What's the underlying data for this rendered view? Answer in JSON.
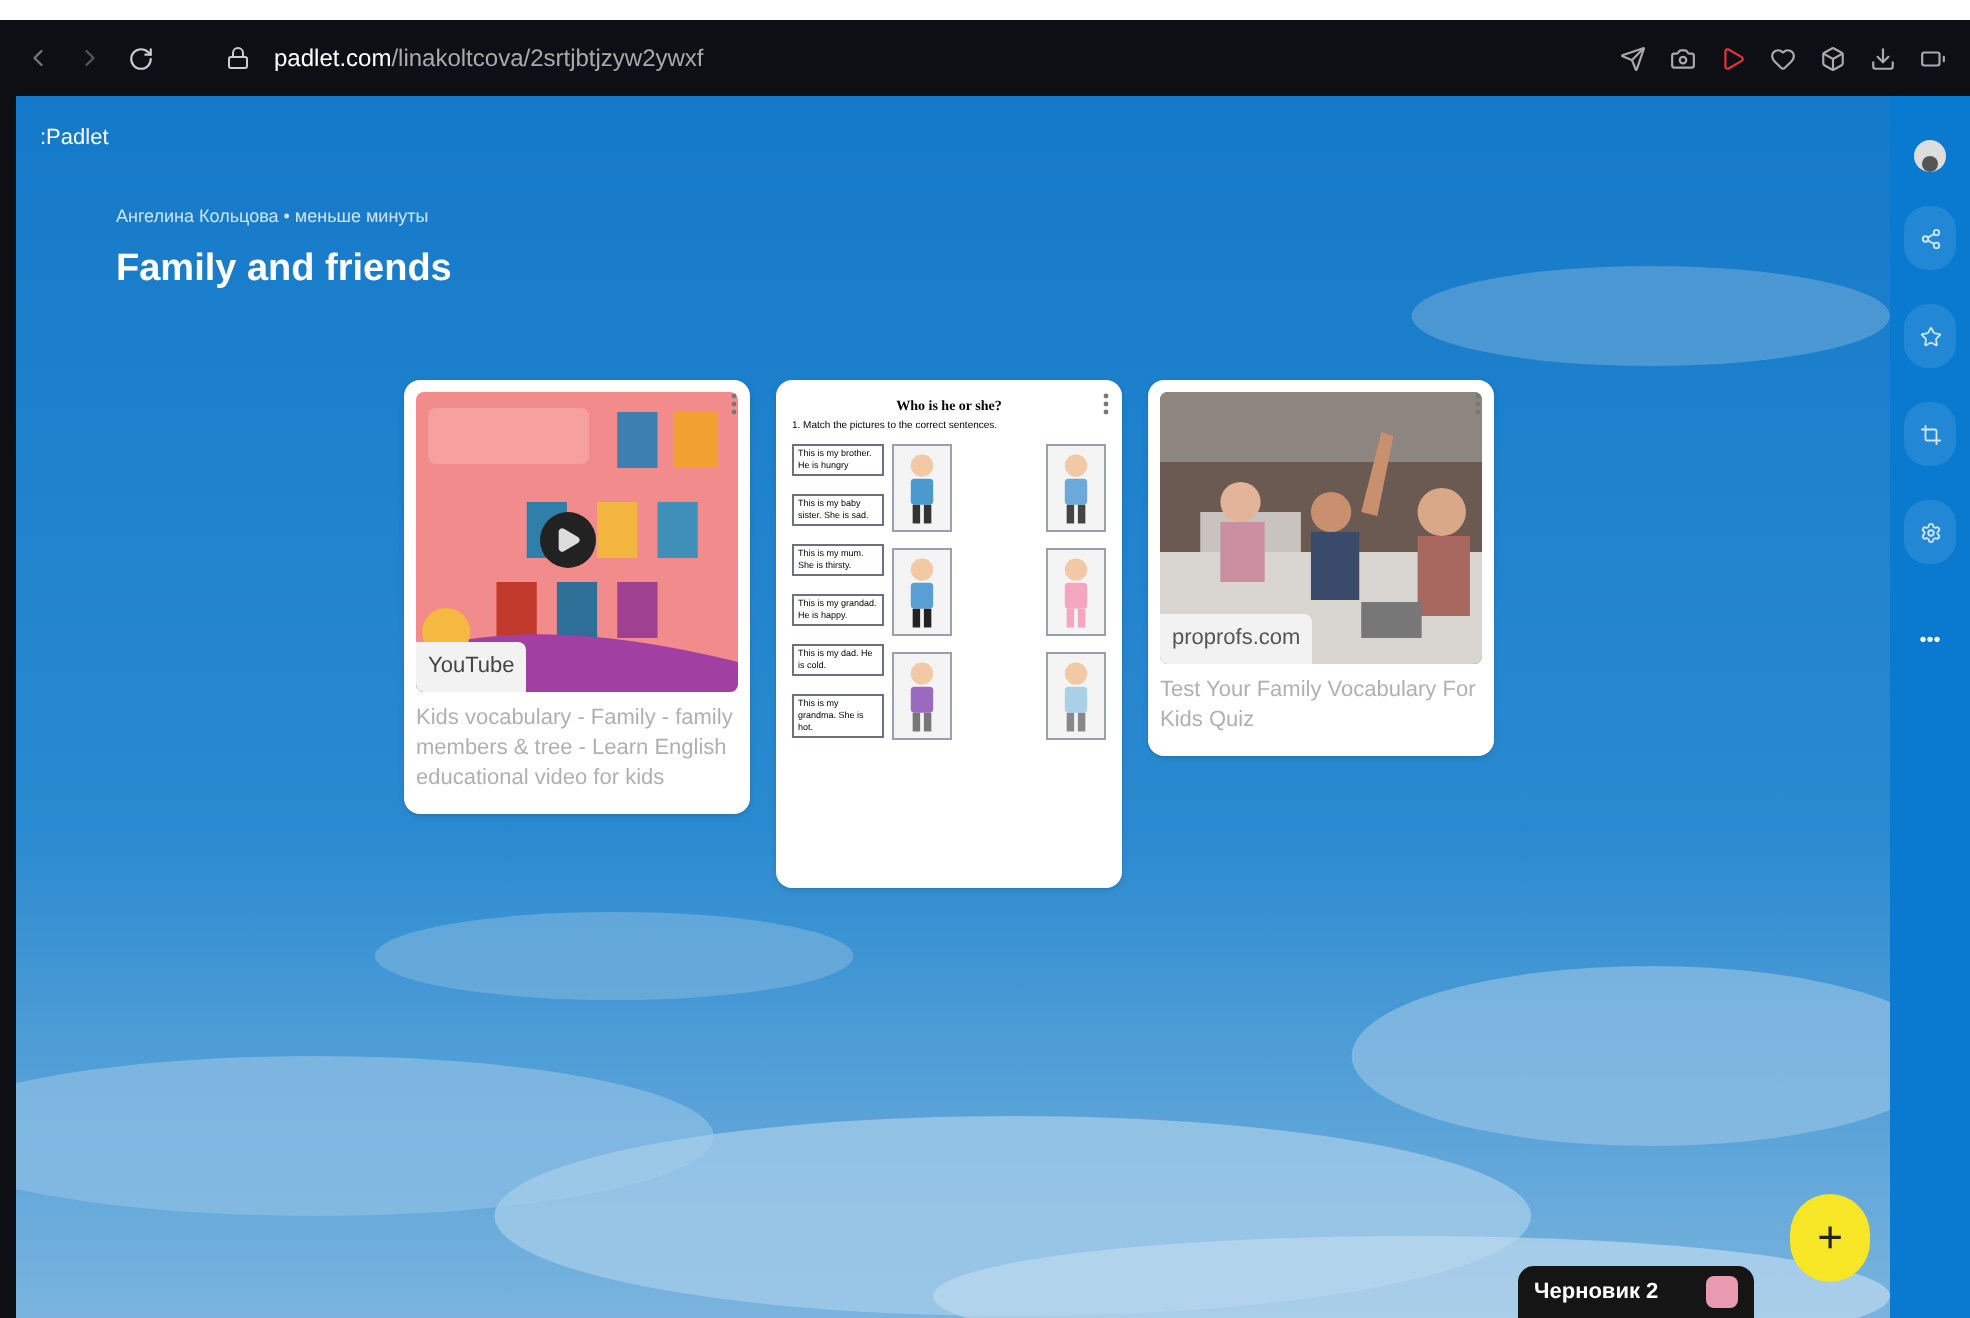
{
  "browser": {
    "url_host": "padlet.com",
    "url_path": "/linakoltcova/2srtjbtjzyw2ywxf"
  },
  "header": {
    "logo": ":Padlet",
    "byline": "Ангелина Кольцова • меньше минуты",
    "title": "Family and friends"
  },
  "posts": [
    {
      "kind": "video",
      "source": "YouTube",
      "caption": "Kids vocabulary - Family - family members & tree - Learn English educational video for kids"
    },
    {
      "kind": "worksheet",
      "heading": "Who is he or she?",
      "instruction": "1. Match the pictures to the correct sentences.",
      "sentences": [
        "This is my brother. He is hungry",
        "This is my baby sister. She is sad.",
        "This is my mum. She is thirsty.",
        "This is my grandad. He is happy.",
        "This is my dad. He is cold.",
        "This is my grandma. She is hot."
      ]
    },
    {
      "kind": "link",
      "source": "proprofs.com",
      "caption": "Test Your Family Vocabulary For Kids Quiz"
    }
  ],
  "sidebar": {
    "more": "•••"
  },
  "draft": {
    "label": "Черновик 2"
  },
  "fab": {
    "symbol": "+"
  }
}
